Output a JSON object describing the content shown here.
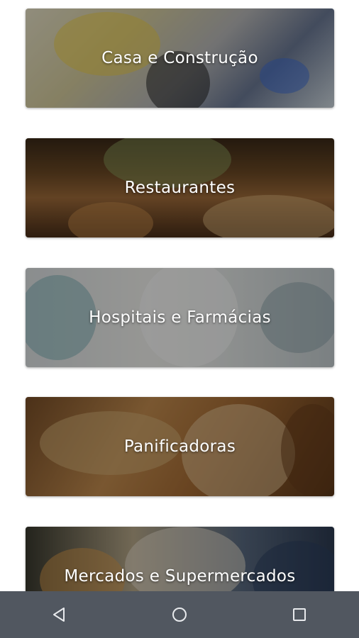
{
  "categories": [
    {
      "label": "Casa e Construção"
    },
    {
      "label": "Restaurantes"
    },
    {
      "label": "Hospitais e Farmácias"
    },
    {
      "label": "Panificadoras"
    },
    {
      "label": "Mercados e Supermercados"
    }
  ],
  "navbar": {
    "back_icon": "triangle-back-icon",
    "home_icon": "circle-home-icon",
    "recents_icon": "square-recents-icon",
    "color": "#515760"
  }
}
